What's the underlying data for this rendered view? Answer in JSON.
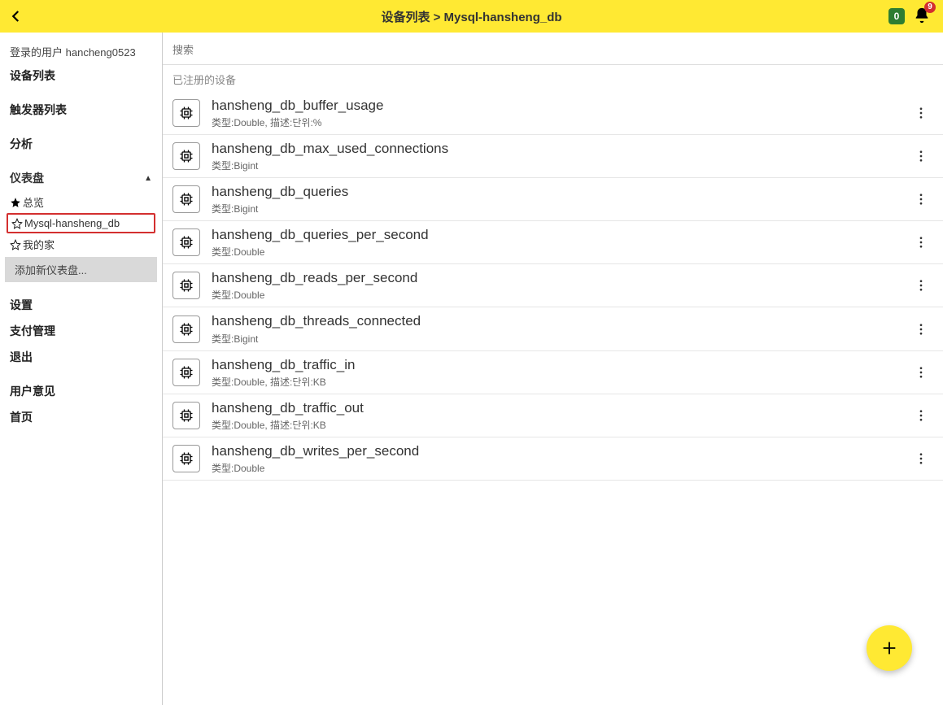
{
  "header": {
    "breadcrumb": "设备列表 > Mysql-hansheng_db",
    "badge_zero": "0",
    "bell_badge": "9"
  },
  "sidebar": {
    "user_prefix": "登录的用户",
    "user_name": "hancheng0523",
    "device_list": "设备列表",
    "trigger_list": "触发器列表",
    "analysis": "分析",
    "dashboard": "仪表盘",
    "dash_items": [
      {
        "label": "总览",
        "filled": true
      },
      {
        "label": "Mysql-hansheng_db",
        "filled": false,
        "highlight": true
      },
      {
        "label": "我的家",
        "filled": false
      }
    ],
    "add_dash": "添加新仪表盘...",
    "settings": "设置",
    "payment": "支付管理",
    "logout": "退出",
    "feedback": "用户意见",
    "home": "首页"
  },
  "main": {
    "search_placeholder": "搜索",
    "list_header": "已注册的设备",
    "rows": [
      {
        "title": "hansheng_db_buffer_usage",
        "meta": "类型:Double, 描述:단위:%"
      },
      {
        "title": "hansheng_db_max_used_connections",
        "meta": "类型:Bigint"
      },
      {
        "title": "hansheng_db_queries",
        "meta": "类型:Bigint"
      },
      {
        "title": "hansheng_db_queries_per_second",
        "meta": "类型:Double"
      },
      {
        "title": "hansheng_db_reads_per_second",
        "meta": "类型:Double"
      },
      {
        "title": "hansheng_db_threads_connected",
        "meta": "类型:Bigint"
      },
      {
        "title": "hansheng_db_traffic_in",
        "meta": "类型:Double, 描述:단위:KB"
      },
      {
        "title": "hansheng_db_traffic_out",
        "meta": "类型:Double, 描述:단위:KB"
      },
      {
        "title": "hansheng_db_writes_per_second",
        "meta": "类型:Double"
      }
    ]
  }
}
